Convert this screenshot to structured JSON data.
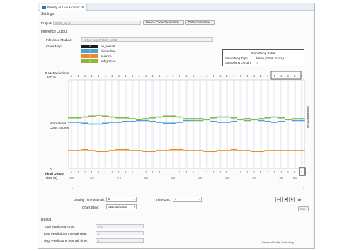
{
  "window": {
    "tab_title": "Reality AI Live Monitor",
    "tab_close": "✕"
  },
  "settings": {
    "section_title": "Settings",
    "project_label": "Project:",
    "project_value": "2025_11_24",
    "device_code_button": "Device Code Generation...",
    "data_connection_button": "Data connection..."
  },
  "inference": {
    "section_title": "Inference Output",
    "module_label": "Inference Module:",
    "module_value": "fortyai-bagel07196_sel02",
    "class_map_label": "Class Map:",
    "classes": [
      {
        "index": "0",
        "name": "no_results",
        "color": "#1a1a1a"
      },
      {
        "index": "1",
        "name": "chamorine",
        "color": "#4aa3d4"
      },
      {
        "index": "2",
        "name": "science",
        "color": "#e98a2c"
      },
      {
        "index": "3",
        "name": "softgrance",
        "color": "#8cb43f"
      }
    ]
  },
  "smoothing": {
    "title": "Smoothing Buffer",
    "type_label": "Smoothing Type:",
    "type_value": "Mean (Class Score)",
    "length_label": "Smoothing Length:",
    "length_value": "7"
  },
  "chart_labels": {
    "raw_predictions": "Raw Predictions",
    "percent_100": "100 %",
    "normalized": "Normalized",
    "class_scores": "Class Scores",
    "zero": "0",
    "final_output": "Final Output",
    "time_label": "Time (s)",
    "smoothed_result": "Smoothed Result"
  },
  "chart_data": {
    "type": "line",
    "ylabel": "Normalized Class Scores",
    "xlabel": "Time (s)",
    "ylim": [
      0,
      1
    ],
    "x_count": 35,
    "raw_predictions": [
      "1",
      "1",
      "1",
      "1",
      "1",
      "1",
      "1",
      "1",
      "1",
      "1",
      "1",
      "1",
      "1",
      "1",
      "1",
      "1",
      "1",
      "1",
      "1",
      "1",
      "1",
      "1",
      "1",
      "1",
      "1",
      "1",
      "1",
      "1",
      "1",
      "1",
      "1",
      "1",
      "1",
      "1",
      "1"
    ],
    "final_output": [
      "1",
      "1",
      "1",
      "1",
      "1",
      "1",
      "1",
      "1",
      "1",
      "1",
      "1",
      "1",
      "1",
      "1",
      "1",
      "1",
      "1",
      "1",
      "1",
      "1",
      "1",
      "1",
      "1",
      "1",
      "1",
      "1",
      "1",
      "1",
      "1",
      "1",
      "1",
      "1",
      "1",
      "1",
      "1"
    ],
    "x_tick_labels": [
      "260",
      "",
      "",
      "270",
      "",
      "",
      "",
      "275",
      "",
      "",
      "",
      "280",
      "",
      "",
      "",
      "285",
      "",
      "",
      "",
      "290",
      "",
      "",
      "",
      "295",
      "",
      "",
      "",
      "300",
      "",
      "",
      "",
      "305",
      "",
      "310",
      ""
    ],
    "series": [
      {
        "name": "chamorine",
        "color": "#4aa3d4",
        "values": [
          0.52,
          0.52,
          0.51,
          0.5,
          0.5,
          0.51,
          0.52,
          0.52,
          0.53,
          0.53,
          0.54,
          0.54,
          0.53,
          0.52,
          0.51,
          0.51,
          0.52,
          0.54,
          0.56,
          0.56,
          0.55,
          0.53,
          0.52,
          0.52,
          0.53,
          0.55,
          0.56,
          0.55,
          0.54,
          0.53,
          0.52,
          0.53,
          0.55,
          0.54,
          0.54
        ]
      },
      {
        "name": "softgrance",
        "color": "#8cb43f",
        "values": [
          0.57,
          0.57,
          0.58,
          0.59,
          0.6,
          0.59,
          0.58,
          0.57,
          0.57,
          0.56,
          0.55,
          0.56,
          0.57,
          0.58,
          0.59,
          0.59,
          0.58,
          0.56,
          0.54,
          0.54,
          0.55,
          0.57,
          0.58,
          0.58,
          0.57,
          0.55,
          0.54,
          0.55,
          0.56,
          0.57,
          0.58,
          0.57,
          0.55,
          0.56,
          0.56
        ]
      },
      {
        "name": "science",
        "color": "#e98a2c",
        "values": [
          0.2,
          0.2,
          0.21,
          0.2,
          0.19,
          0.19,
          0.2,
          0.21,
          0.21,
          0.2,
          0.2,
          0.19,
          0.19,
          0.2,
          0.2,
          0.21,
          0.21,
          0.2,
          0.2,
          0.2,
          0.19,
          0.19,
          0.2,
          0.2,
          0.21,
          0.2,
          0.2,
          0.19,
          0.19,
          0.2,
          0.2,
          0.2,
          0.2,
          0.2,
          0.2
        ]
      }
    ]
  },
  "controls": {
    "display_interval_label": "Display Time Interval:",
    "display_interval_value": "5",
    "time_unit_label": "Time Unit:",
    "time_unit_value": "s",
    "chart_style_label": "Chart Style:",
    "chart_style_value": "Stacked Chart",
    "nav_buttons": [
      "⏮",
      "◀",
      "▶",
      "⏭"
    ],
    "start_button": "Start"
  },
  "result": {
    "section_title": "Result",
    "total_time_label": "Total Monitored Time:",
    "total_time_value": "371",
    "last_interval_label": "Last Predictions Interval Time:",
    "last_interval_value": "1",
    "avg_interval_label": "Avg. Predictions Interval Time:",
    "avg_interval_value": "1",
    "footer": "Renesas Reality Technology"
  }
}
